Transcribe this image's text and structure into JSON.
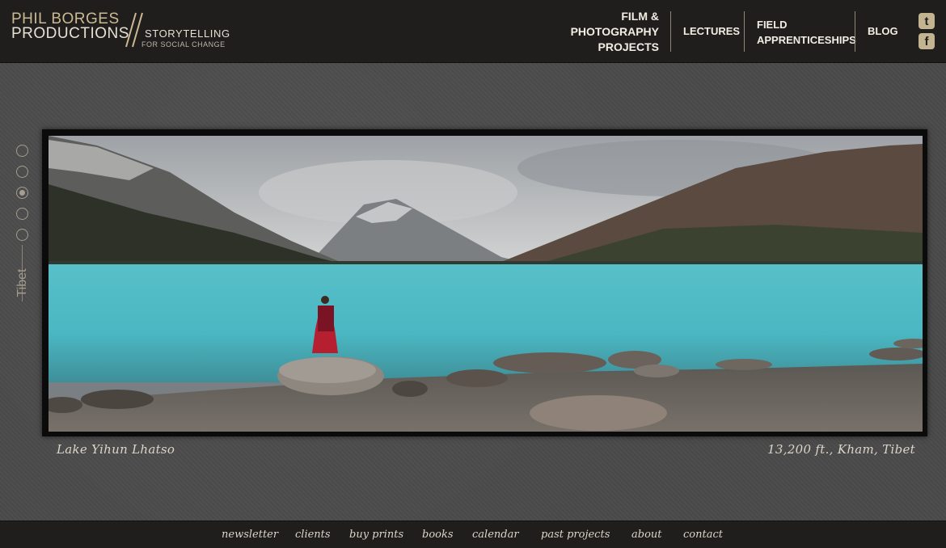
{
  "logo": {
    "line1": "PHIL BORGES",
    "line2": "PRODUCTIONS",
    "tagline": "STORYTELLING",
    "subtag": "FOR SOCIAL CHANGE"
  },
  "nav": {
    "film_1": "FILM &",
    "film_2": "PHOTOGRAPHY",
    "film_3": "PROJECTS",
    "lectures": "LECTURES",
    "field_1": "FIELD",
    "field_2": "APPRENTICESHIPS",
    "blog": "BLOG"
  },
  "social": {
    "twitter_glyph": "t",
    "facebook_glyph": "f",
    "twitter_icon": "twitter-icon",
    "facebook_icon": "facebook-icon"
  },
  "gallery": {
    "section_label": "Tibet",
    "slide_count": 5,
    "active_slide": 3
  },
  "caption": {
    "title": "Lake Yihun Lhatso",
    "location": "13,200 ft., Kham, Tibet"
  },
  "footer": {
    "links": [
      "newsletter",
      "clients",
      "buy prints",
      "books",
      "calendar",
      "past projects",
      "about",
      "contact"
    ]
  },
  "colors": {
    "header_bg": "#1f1e1d",
    "page_bg": "#4a4a4a",
    "accent_gold": "#c3b491",
    "text_light": "#f1ede4"
  }
}
